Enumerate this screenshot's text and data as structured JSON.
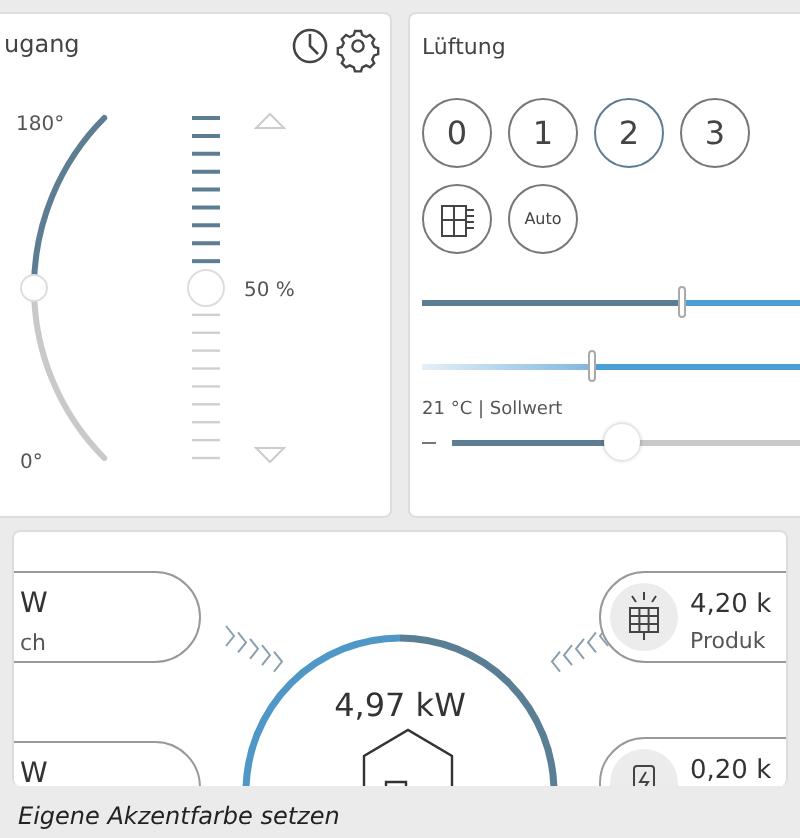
{
  "heating": {
    "title": "ugang",
    "angle_max": "180°",
    "angle_min": "0°",
    "arc": {
      "level": 0.5
    },
    "bar": {
      "level": 0.5
    },
    "bar_reading": "50 %"
  },
  "ventilation": {
    "title": "Lüftung",
    "levels": [
      {
        "label": "0",
        "selected": false
      },
      {
        "label": "1",
        "selected": false
      },
      {
        "label": "2",
        "selected": true
      },
      {
        "label": "3",
        "selected": false
      }
    ],
    "modes": [
      {
        "kind": "icon"
      },
      {
        "kind": "text",
        "label": "Auto"
      }
    ],
    "sliders": [
      {
        "kind": "dark",
        "level": 0.69
      },
      {
        "kind": "light",
        "level": 0.45
      }
    ],
    "setpoint": {
      "label": "21 °C | Sollwert",
      "level": 0.49
    }
  },
  "energy": {
    "center_value": "4,97 kW",
    "left": [
      {
        "value": "W",
        "label": "ch"
      },
      {
        "value": "W"
      }
    ],
    "right": [
      {
        "kind": "solar",
        "value": "4,20 k",
        "label": "Produk"
      },
      {
        "kind": "battery",
        "value": "0,20 k"
      }
    ]
  },
  "caption": "Eigene Akzentfarbe setzen"
}
